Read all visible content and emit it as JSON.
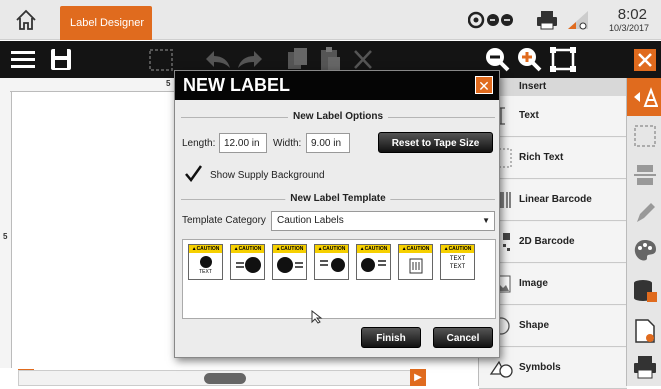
{
  "window": {
    "tab_label": "Label Designer",
    "time": "8:02",
    "date": "10/3/2017"
  },
  "colors": {
    "accent": "#e06b1e",
    "toolbar": "#141414",
    "dialog_title": "#050505",
    "caution_yellow": "#f6d000"
  },
  "toolbar": {
    "tools": [
      "menu-icon",
      "save-icon",
      "select-icon",
      "undo-icon",
      "redo-icon",
      "copy-icon",
      "paste-icon",
      "delete-icon",
      "zoom-out-icon",
      "zoom-in-icon",
      "fit-icon",
      "close-icon"
    ]
  },
  "ruler": {
    "top_mark": "5",
    "left_mark": "5"
  },
  "insert_panel": {
    "header": "Insert",
    "items": [
      {
        "label": "Text",
        "icon": "text-icon"
      },
      {
        "label": "Rich Text",
        "icon": "rich-text-icon"
      },
      {
        "label": "Linear Barcode",
        "icon": "linear-barcode-icon"
      },
      {
        "label": "2D Barcode",
        "icon": "2d-barcode-icon"
      },
      {
        "label": "Image",
        "icon": "image-icon"
      },
      {
        "label": "Shape",
        "icon": "shape-icon"
      },
      {
        "label": "Symbols",
        "icon": "symbols-icon"
      }
    ]
  },
  "sidebar": {
    "icons": [
      "insert-icon",
      "select-area-icon",
      "align-icon",
      "edit-icon",
      "palette-icon",
      "database-icon",
      "document-settings-icon",
      "print-icon"
    ]
  },
  "dialog": {
    "title": "NEW LABEL",
    "options_section": "New Label Options",
    "length_label": "Length:",
    "length_value": "12.00 in",
    "width_label": "Width:",
    "width_value": "9.00 in",
    "reset_button": "Reset to Tape Size",
    "show_background_label": "Show Supply Background",
    "show_background_checked": true,
    "template_section": "New Label Template",
    "category_label": "Template Category",
    "category_value": "Caution Labels",
    "template_header": "▲CAUTION",
    "template_text": "TEXT",
    "finish_button": "Finish",
    "cancel_button": "Cancel"
  }
}
